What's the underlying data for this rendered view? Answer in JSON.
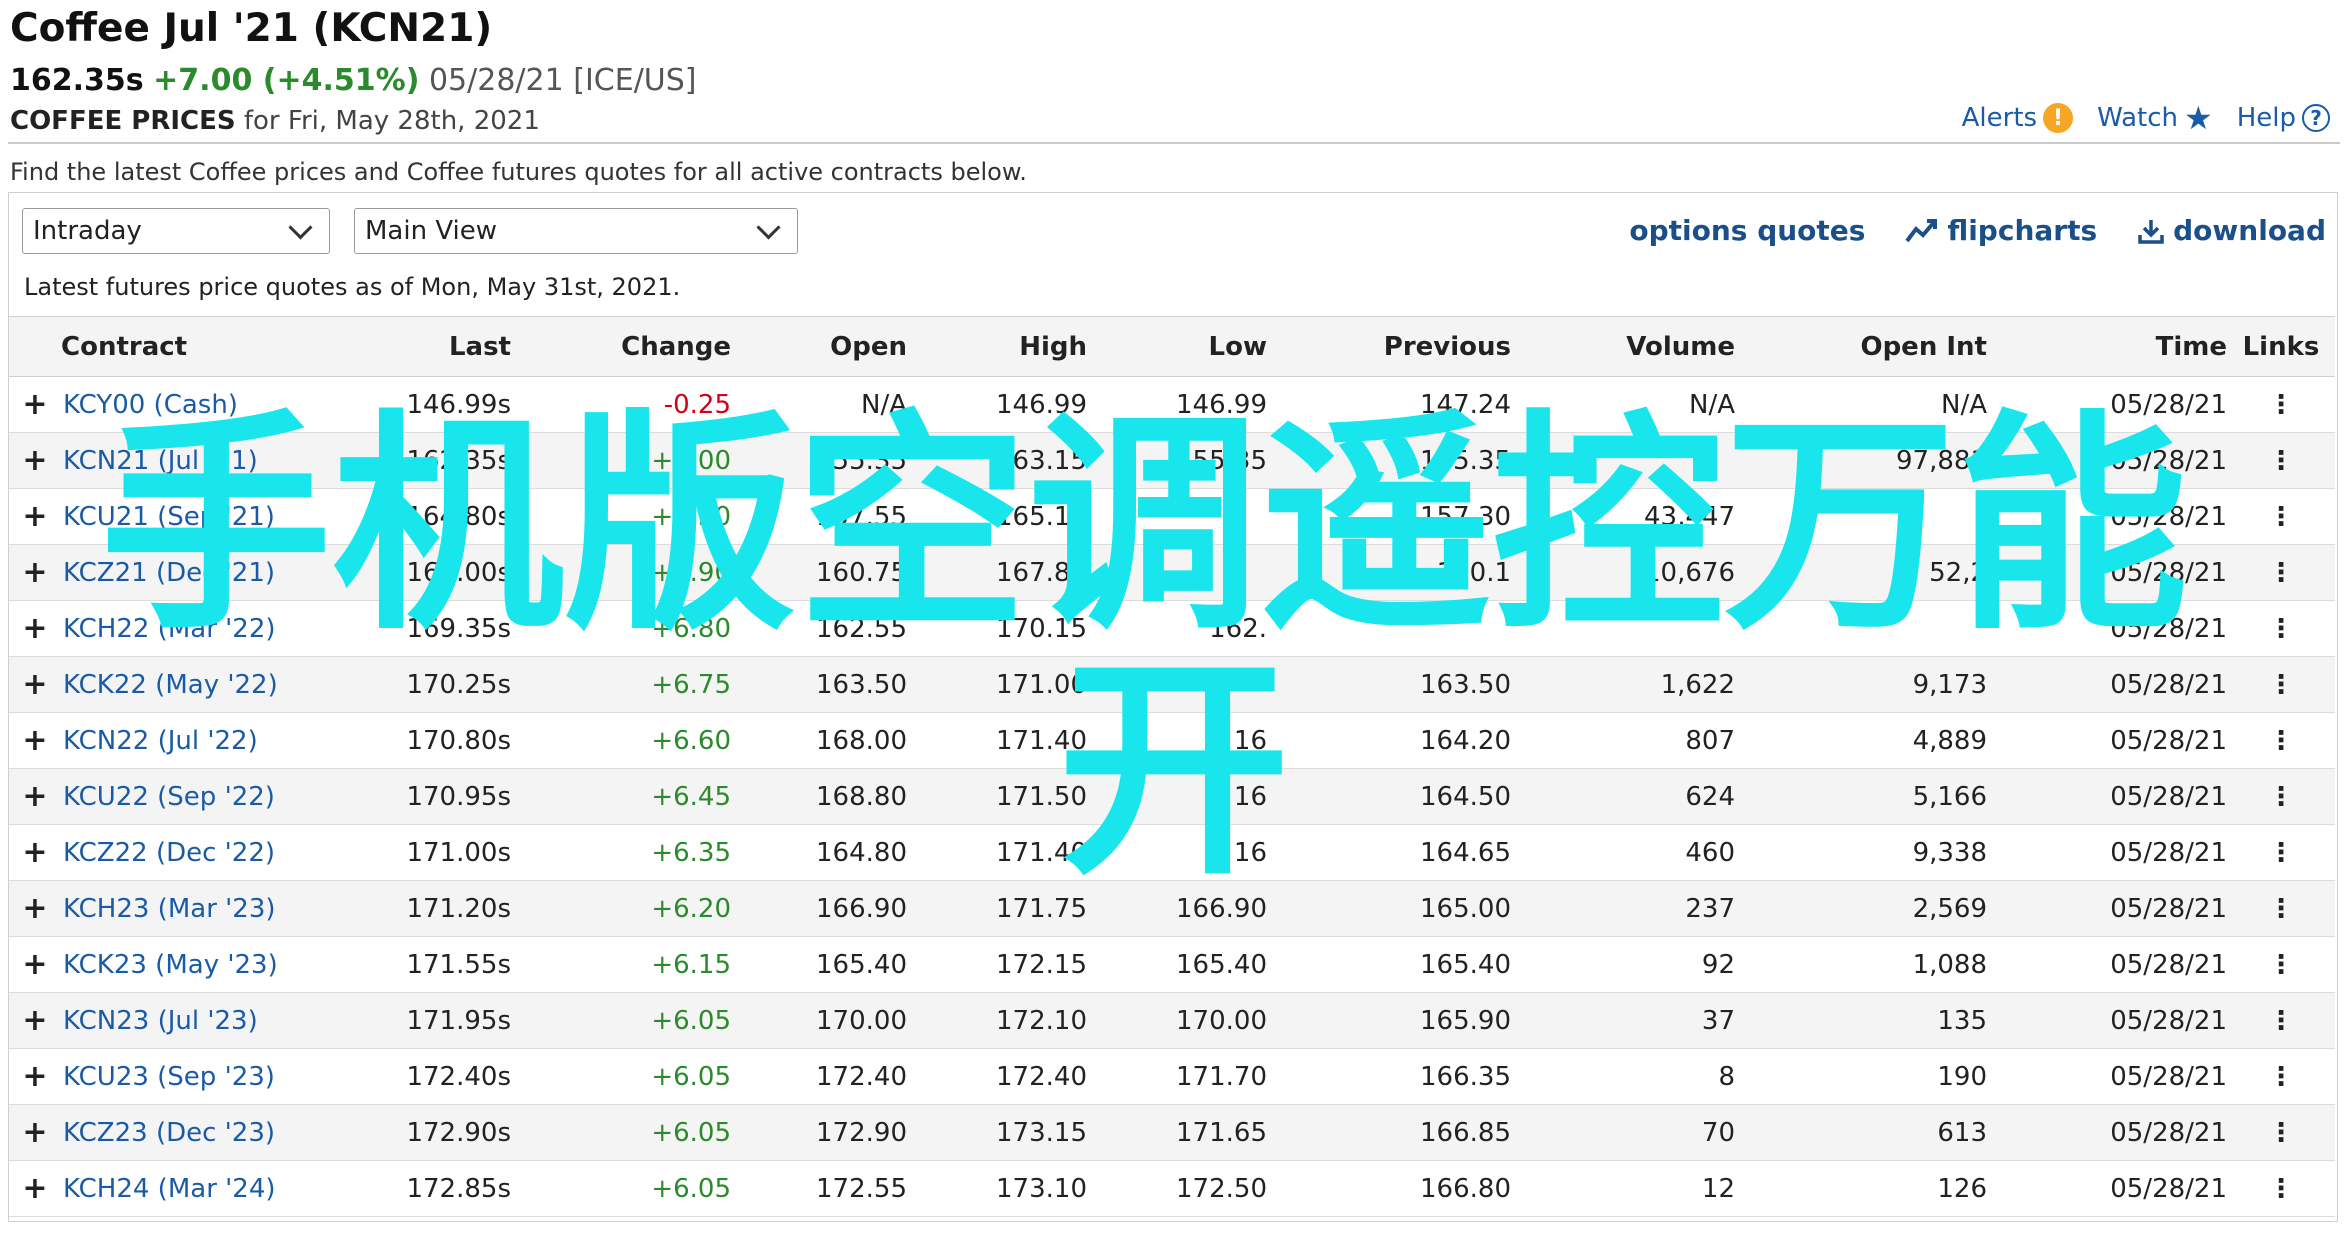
{
  "header": {
    "title": "Coffee Jul '21 (KCN21)",
    "last": "162.35s",
    "change": "+7.00 (+4.51%)",
    "date_exchange": "05/28/21 [ICE/US]",
    "subtitle_bold": "COFFEE PRICES",
    "subtitle_rest": "for Fri, May 28th, 2021"
  },
  "toplinks": {
    "alerts": "Alerts",
    "watch": "Watch",
    "help": "Help",
    "alert_glyph": "!",
    "help_glyph": "?"
  },
  "description": "Find the latest Coffee prices and Coffee futures quotes for all active contracts below.",
  "controls": {
    "period_select": "Intraday",
    "view_select": "Main View"
  },
  "tools": {
    "options_quotes": "options quotes",
    "flipcharts": "flipcharts",
    "download": "download"
  },
  "as_of": "Latest futures price quotes as of Mon, May 31st, 2021.",
  "table": {
    "headers": {
      "contract": "Contract",
      "last": "Last",
      "change": "Change",
      "open": "Open",
      "high": "High",
      "low": "Low",
      "previous": "Previous",
      "volume": "Volume",
      "open_int": "Open Int",
      "time": "Time",
      "links": "Links"
    },
    "rows": [
      {
        "contract": "KCY00 (Cash)",
        "last": "146.99s",
        "change": "-0.25",
        "dir": "neg",
        "open": "N/A",
        "high": "146.99",
        "low": "146.99",
        "previous": "147.24",
        "volume": "N/A",
        "open_int": "N/A",
        "time": "05/28/21"
      },
      {
        "contract": "KCN21 (Jul '21)",
        "last": "162.35s",
        "change": "+7.00",
        "dir": "pos",
        "open": "155.35",
        "high": "163.15",
        "low": "155.35",
        "previous": "155.35",
        "volume": "",
        "open_int": "97,881",
        "time": "05/28/21"
      },
      {
        "contract": "KCU21 (Sep '21)",
        "last": "164.80s",
        "change": "+7.50",
        "dir": "pos",
        "open": "157.55",
        "high": "165.10",
        "low": "",
        "previous": "157.30",
        "volume": "43,447",
        "open_int": "",
        "time": "05/28/21"
      },
      {
        "contract": "KCZ21 (Dec '21)",
        "last": "167.00s",
        "change": "+6.90",
        "dir": "pos",
        "open": "160.75",
        "high": "167.85",
        "low": "",
        "previous": "160.1",
        "volume": "10,676",
        "open_int": "52,2",
        "time": "05/28/21"
      },
      {
        "contract": "KCH22 (Mar '22)",
        "last": "169.35s",
        "change": "+6.80",
        "dir": "pos",
        "open": "162.55",
        "high": "170.15",
        "low": "162.",
        "previous": "",
        "volume": "",
        "open_int": "",
        "time": "05/28/21"
      },
      {
        "contract": "KCK22 (May '22)",
        "last": "170.25s",
        "change": "+6.75",
        "dir": "pos",
        "open": "163.50",
        "high": "171.00",
        "low": "",
        "previous": "163.50",
        "volume": "1,622",
        "open_int": "9,173",
        "time": "05/28/21"
      },
      {
        "contract": "KCN22 (Jul '22)",
        "last": "170.80s",
        "change": "+6.60",
        "dir": "pos",
        "open": "168.00",
        "high": "171.40",
        "low": "16",
        "previous": "164.20",
        "volume": "807",
        "open_int": "4,889",
        "time": "05/28/21"
      },
      {
        "contract": "KCU22 (Sep '22)",
        "last": "170.95s",
        "change": "+6.45",
        "dir": "pos",
        "open": "168.80",
        "high": "171.50",
        "low": "16",
        "previous": "164.50",
        "volume": "624",
        "open_int": "5,166",
        "time": "05/28/21"
      },
      {
        "contract": "KCZ22 (Dec '22)",
        "last": "171.00s",
        "change": "+6.35",
        "dir": "pos",
        "open": "164.80",
        "high": "171.40",
        "low": "16",
        "previous": "164.65",
        "volume": "460",
        "open_int": "9,338",
        "time": "05/28/21"
      },
      {
        "contract": "KCH23 (Mar '23)",
        "last": "171.20s",
        "change": "+6.20",
        "dir": "pos",
        "open": "166.90",
        "high": "171.75",
        "low": "166.90",
        "previous": "165.00",
        "volume": "237",
        "open_int": "2,569",
        "time": "05/28/21"
      },
      {
        "contract": "KCK23 (May '23)",
        "last": "171.55s",
        "change": "+6.15",
        "dir": "pos",
        "open": "165.40",
        "high": "172.15",
        "low": "165.40",
        "previous": "165.40",
        "volume": "92",
        "open_int": "1,088",
        "time": "05/28/21"
      },
      {
        "contract": "KCN23 (Jul '23)",
        "last": "171.95s",
        "change": "+6.05",
        "dir": "pos",
        "open": "170.00",
        "high": "172.10",
        "low": "170.00",
        "previous": "165.90",
        "volume": "37",
        "open_int": "135",
        "time": "05/28/21"
      },
      {
        "contract": "KCU23 (Sep '23)",
        "last": "172.40s",
        "change": "+6.05",
        "dir": "pos",
        "open": "172.40",
        "high": "172.40",
        "low": "171.70",
        "previous": "166.35",
        "volume": "8",
        "open_int": "190",
        "time": "05/28/21"
      },
      {
        "contract": "KCZ23 (Dec '23)",
        "last": "172.90s",
        "change": "+6.05",
        "dir": "pos",
        "open": "172.90",
        "high": "173.15",
        "low": "171.65",
        "previous": "166.85",
        "volume": "70",
        "open_int": "613",
        "time": "05/28/21"
      },
      {
        "contract": "KCH24 (Mar '24)",
        "last": "172.85s",
        "change": "+6.05",
        "dir": "pos",
        "open": "172.55",
        "high": "173.10",
        "low": "172.50",
        "previous": "166.80",
        "volume": "12",
        "open_int": "126",
        "time": "05/28/21"
      }
    ]
  },
  "watermark": {
    "line1": "手机版空调遥控万能",
    "line2": "开",
    "color": "#19e6ec"
  },
  "colors": {
    "link": "#1a5ba8",
    "positive": "#2b8a2b",
    "negative": "#d0021b",
    "alert": "#f5a623"
  }
}
